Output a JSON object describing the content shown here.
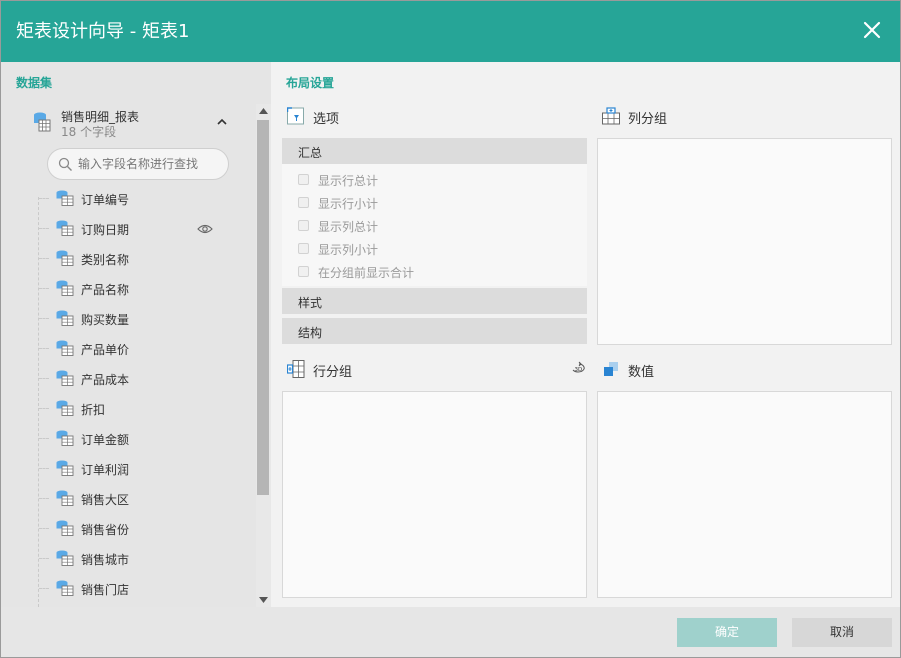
{
  "dialog": {
    "title": "矩表设计向导 - 矩表1"
  },
  "left": {
    "title": "数据集",
    "dataset": {
      "name": "销售明细_报表",
      "subtitle": "18 个字段"
    },
    "search_placeholder": "输入字段名称进行查找",
    "fields": [
      {
        "label": "订单编号"
      },
      {
        "label": "订购日期"
      },
      {
        "label": "类别名称"
      },
      {
        "label": "产品名称"
      },
      {
        "label": "购买数量"
      },
      {
        "label": "产品单价"
      },
      {
        "label": "产品成本"
      },
      {
        "label": "折扣"
      },
      {
        "label": "订单金额"
      },
      {
        "label": "订单利润"
      },
      {
        "label": "销售大区"
      },
      {
        "label": "销售省份"
      },
      {
        "label": "销售城市"
      },
      {
        "label": "销售门店"
      }
    ]
  },
  "right": {
    "title": "布局设置",
    "options_title": "选项",
    "summary_label": "汇总",
    "options": [
      {
        "label": "显示行总计",
        "checked": false
      },
      {
        "label": "显示行小计",
        "checked": false
      },
      {
        "label": "显示列总计",
        "checked": false
      },
      {
        "label": "显示列小计",
        "checked": false
      },
      {
        "label": "在分组前显示合计",
        "checked": false
      }
    ],
    "style_label": "样式",
    "structure_label": "结构",
    "column_group_title": "列分组",
    "row_group_title": "行分组",
    "values_title": "数值",
    "icon_3d_label": "3D"
  },
  "footer": {
    "ok_label": "确定",
    "cancel_label": "取消"
  },
  "colors": {
    "accent": "#26a597",
    "ok_disabled": "#9fd1cc",
    "cancel_bg": "#d7d7d7",
    "field_icon": "#5aa9e6"
  }
}
